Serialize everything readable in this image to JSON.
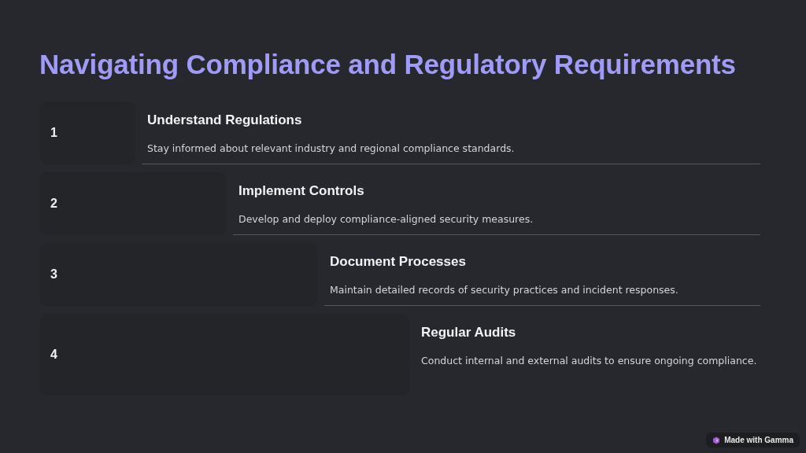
{
  "title": "Navigating Compliance and Regulatory Requirements",
  "steps": [
    {
      "number": "1",
      "heading": "Understand Regulations",
      "text": "Stay informed about relevant industry and regional compliance standards."
    },
    {
      "number": "2",
      "heading": "Implement Controls",
      "text": "Develop and deploy compliance-aligned security measures."
    },
    {
      "number": "3",
      "heading": "Document Processes",
      "text": "Maintain detailed records of security practices and incident responses."
    },
    {
      "number": "4",
      "heading": "Regular Audits",
      "text": "Conduct internal and external audits to ensure ongoing compliance."
    }
  ],
  "badge": {
    "label": "Made with Gamma"
  }
}
